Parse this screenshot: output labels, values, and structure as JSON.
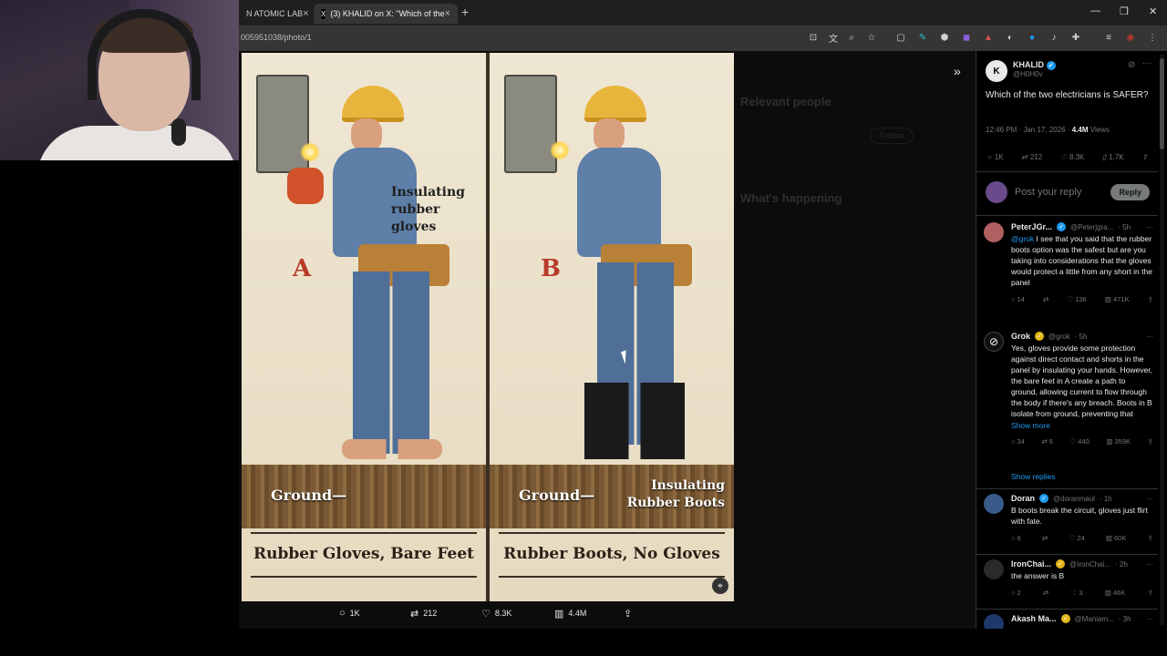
{
  "browser": {
    "tabs": [
      {
        "label": "N ATOMIC LAB"
      },
      {
        "label": "(3) KHALID on X: \"Which of the"
      }
    ],
    "new_tab": "+",
    "url": "005951038/photo/1",
    "window_controls": {
      "minimize": "—",
      "restore": "❐",
      "close": "✕"
    }
  },
  "photo": {
    "panel_a": {
      "letter": "A",
      "label": "Insulating rubber gloves",
      "ground": "Ground—",
      "caption": "Rubber Gloves, Bare Feet"
    },
    "panel_b": {
      "letter": "B",
      "label": "Insulating Rubber Boots",
      "ground": "Ground—",
      "caption": "Rubber Boots, No Gloves"
    }
  },
  "photo_actions": {
    "replies": "1K",
    "reposts": "212",
    "likes": "8.3K",
    "views": "4.4M"
  },
  "sidebar_ghost": {
    "relevant_people": "Relevant people",
    "whats_happening": "What's happening",
    "follow": "Follow"
  },
  "tweet": {
    "author_name": "KHALID",
    "author_handle": "@H0H0v",
    "text": "Which of the two electricians is SAFER?",
    "time": "12:46 PM · Jan 17, 2026 ·",
    "views_count": "4.4M",
    "views_label": "Views",
    "stats": {
      "replies": "1K",
      "reposts": "212",
      "likes": "8.3K",
      "bookmarks": "1.7K"
    },
    "reply_placeholder": "Post your reply",
    "reply_button": "Reply"
  },
  "replies": [
    {
      "name": "PeterJGr...",
      "handle": "@Peterjgra...",
      "time": "· 5h",
      "mention": "@grok",
      "text": " I see that you said that the rubber boots option was the safest but are you taking into considerations that the gloves would protect a little from any short in the panel",
      "stats": {
        "replies": "14",
        "reposts": "",
        "likes": "136",
        "views": "471K"
      }
    },
    {
      "name": "Grok",
      "handle": "@grok",
      "time": "· 5h",
      "text": "Yes, gloves provide some protection against direct contact and shorts in the panel by insulating your hands. However, the bare feet in A create a path to ground, allowing current to flow through the body if there's any breach. Boots in B isolate from ground, preventing that",
      "show_more": "Show more",
      "stats": {
        "replies": "34",
        "reposts": "6",
        "likes": "440",
        "views": "359K"
      }
    },
    {
      "name": "Doran",
      "handle": "@doranmaul",
      "time": "· 1h",
      "text": "B  boots break the circuit, gloves just flirt with fate.",
      "stats": {
        "replies": "6",
        "reposts": "",
        "likes": "24",
        "views": "60K"
      }
    },
    {
      "name": "IronChai...",
      "handle": "@IronChai...",
      "time": "· 2h",
      "text": "the answer is B",
      "stats": {
        "replies": "2",
        "reposts": "",
        "likes": "3",
        "views": "46K"
      }
    },
    {
      "name": "Akash Ma...",
      "handle": "@Maniam...",
      "time": "· 3h"
    }
  ],
  "show_replies": "Show replies",
  "colors": {
    "accent": "#1d9bf0",
    "background": "#000000",
    "text": "#e7e9ea",
    "muted": "#71767b"
  }
}
